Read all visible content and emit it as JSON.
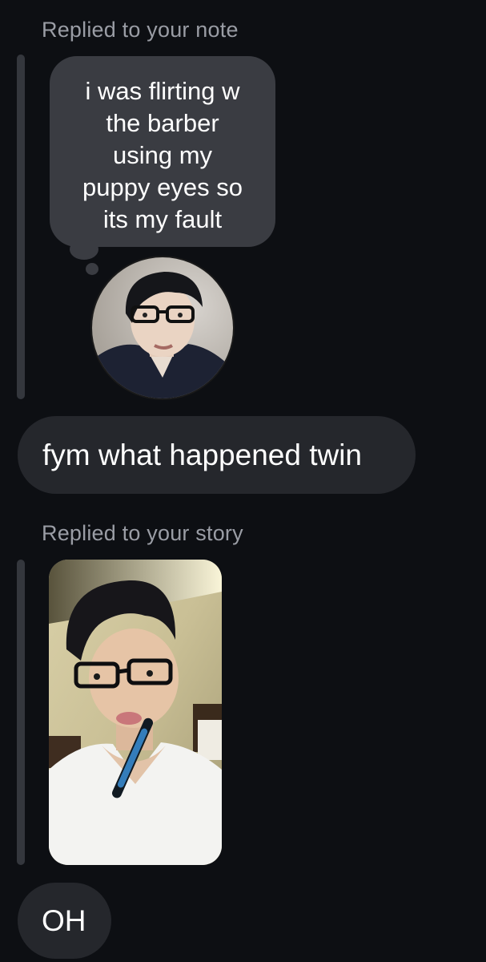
{
  "thread": {
    "note_reply": {
      "caption": "Replied to your note",
      "note_lines": [
        "i was flirting w",
        "the barber",
        "using my",
        "puppy eyes so",
        "its my fault"
      ],
      "avatar_icon": "profile-photo"
    },
    "message_1": "fym what happened twin",
    "story_reply": {
      "caption": "Replied to your story",
      "thumbnail_icon": "story-photo"
    },
    "message_2": "OH"
  },
  "colors": {
    "background": "#0d0f13",
    "bubble": "#25272c",
    "note_bubble": "#3a3c42",
    "caption_text": "#9a9da5",
    "quote_bar": "#34373d"
  }
}
